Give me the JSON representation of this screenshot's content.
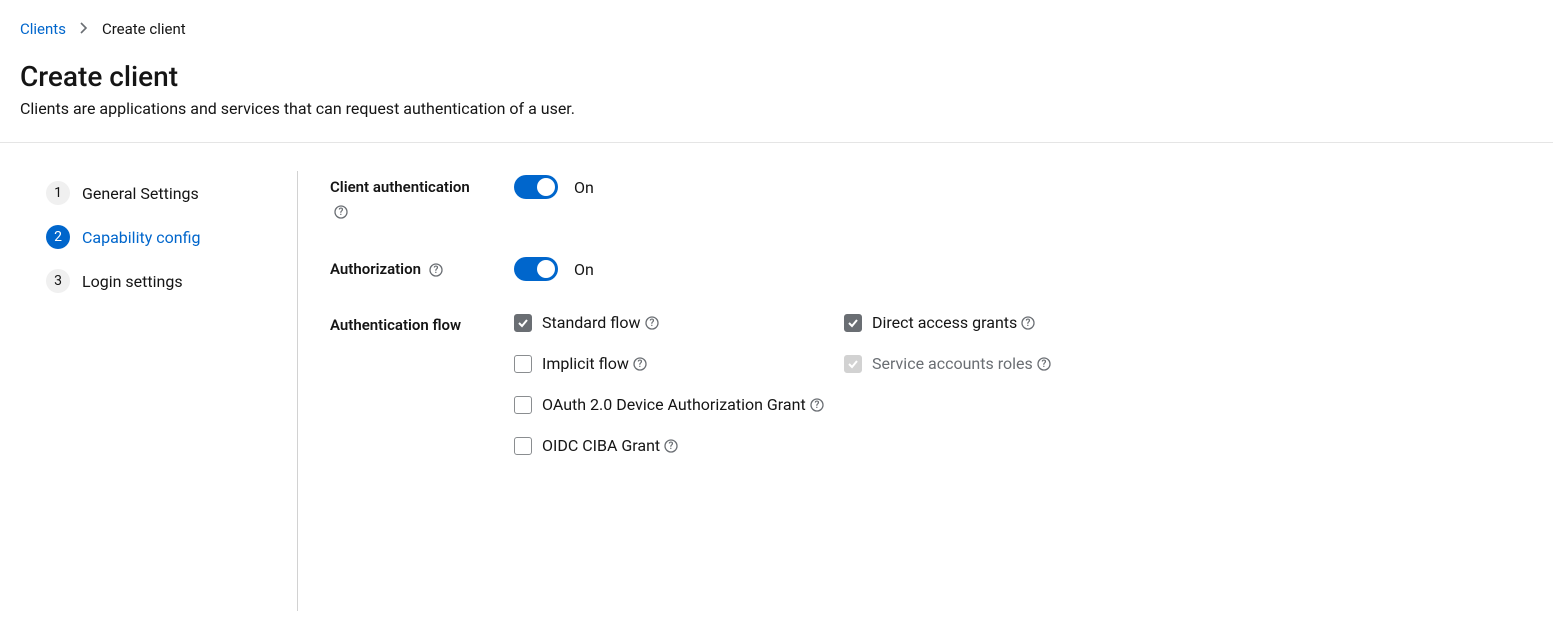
{
  "breadcrumb": {
    "parent": "Clients",
    "current": "Create client"
  },
  "page": {
    "title": "Create client",
    "description": "Clients are applications and services that can request authentication of a user."
  },
  "wizard": {
    "steps": [
      {
        "num": "1",
        "label": "General Settings"
      },
      {
        "num": "2",
        "label": "Capability config"
      },
      {
        "num": "3",
        "label": "Login settings"
      }
    ]
  },
  "form": {
    "client_auth": {
      "label": "Client authentication",
      "state": "On"
    },
    "authorization": {
      "label": "Authorization",
      "state": "On"
    },
    "auth_flow": {
      "label": "Authentication flow",
      "standard": "Standard flow",
      "implicit": "Implicit flow",
      "direct": "Direct access grants",
      "service": "Service accounts roles",
      "device": "OAuth 2.0 Device Authorization Grant",
      "ciba": "OIDC CIBA Grant"
    }
  }
}
